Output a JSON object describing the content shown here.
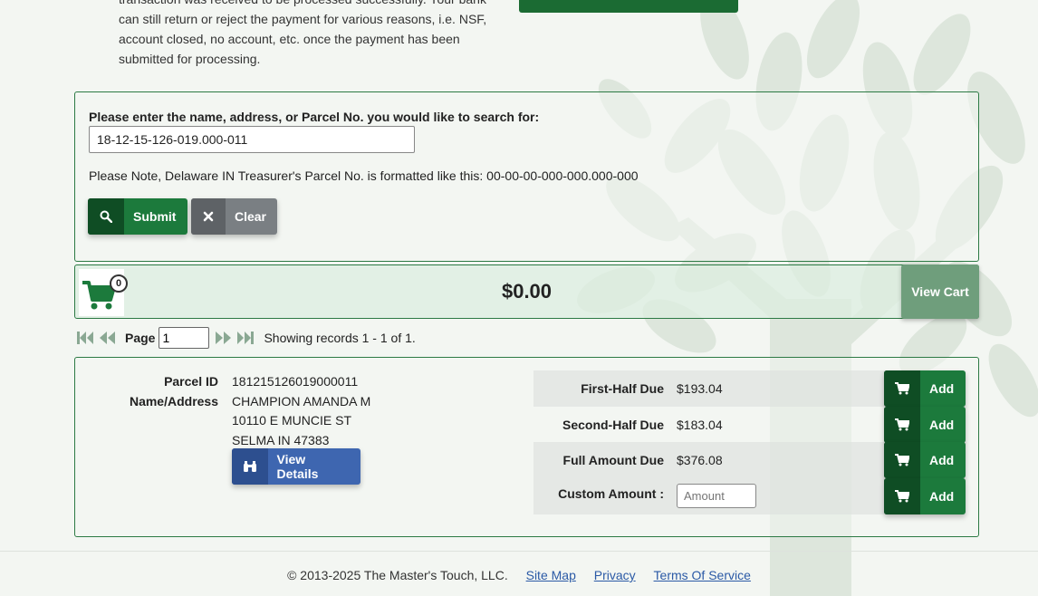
{
  "intro": {
    "lines": [
      "transaction was received to be processed successfully. Your bank",
      "can still return or reject the payment for various reasons, i.e. NSF,",
      "account closed, no account, etc. once the payment has been",
      "submitted for processing."
    ]
  },
  "search": {
    "label": "Please enter the name, address, or Parcel No. you would like to search for:",
    "value": "18-12-15-126-019.000-011",
    "note": "Please Note, Delaware IN Treasurer's Parcel No. is formatted like this: 00-00-00-000-000.000-000",
    "submit_label": "Submit",
    "clear_label": "Clear"
  },
  "cart": {
    "count": "0",
    "total": "$0.00",
    "view_label": "View Cart"
  },
  "pager": {
    "page_label": "Page",
    "page_value": "1",
    "records_text": "Showing records 1 - 1 of 1."
  },
  "result": {
    "parcel_id_label": "Parcel ID",
    "parcel_id": "181215126019000011",
    "name_address_label": "Name/Address",
    "name": "CHAMPION AMANDA M",
    "address1": "10110 E MUNCIE ST",
    "address2": "SELMA IN 47383",
    "view_details_label": "View Details",
    "dues": [
      {
        "label": "First-Half Due",
        "amount": "$193.04"
      },
      {
        "label": "Second-Half Due",
        "amount": "$183.04"
      },
      {
        "label": "Full Amount Due",
        "amount": "$376.08"
      }
    ],
    "custom_label": "Custom Amount :",
    "custom_placeholder": "Amount",
    "add_label": "Add"
  },
  "footer": {
    "copyright": "© 2013-2025 The Master's Touch, LLC.",
    "links": [
      "Site Map",
      "Privacy",
      "Terms Of Service"
    ]
  },
  "colors": {
    "primary_green": "#1c7a3c",
    "dark_green": "#0f4d24",
    "clear_gray": "#7a7f83",
    "details_blue": "#3e66b0",
    "link_blue": "#2b5aa6"
  }
}
